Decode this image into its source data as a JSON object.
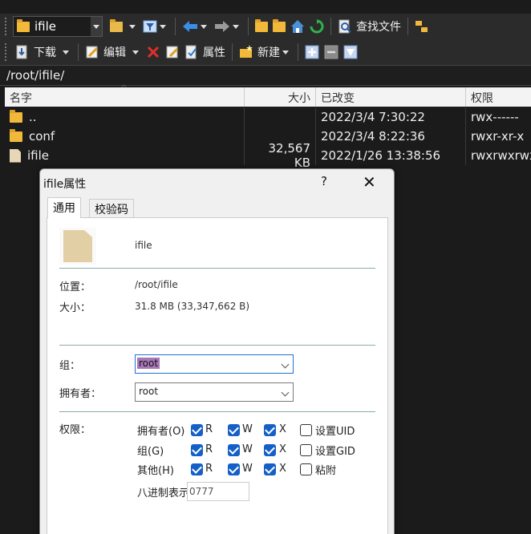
{
  "toolbar1": {
    "folder_combo": "ifile",
    "find_files": "查找文件"
  },
  "toolbar2": {
    "download": "下载",
    "edit": "编辑",
    "properties": "属性",
    "new": "新建"
  },
  "path": "/root/ifile/",
  "columns": {
    "name": "名字",
    "size": "大小",
    "modified": "已改变",
    "permissions": "权限"
  },
  "files": [
    {
      "name": "..",
      "size": "",
      "modified": "2022/3/4 7:30:22",
      "permissions": "rwx------",
      "icon": "parent-folder-icon"
    },
    {
      "name": "conf",
      "size": "",
      "modified": "2022/3/4 8:22:36",
      "permissions": "rwxr-xr-x",
      "icon": "folder-icon"
    },
    {
      "name": "ifile",
      "size": "32,567 KB",
      "modified": "2022/1/26 13:38:56",
      "permissions": "rwxrwxrwx",
      "icon": "file-icon"
    }
  ],
  "dialog": {
    "title": "ifile属性",
    "help": "?",
    "close": "✕",
    "tabs": [
      "通用",
      "校验码"
    ],
    "file_name": "ifile",
    "location_label": "位置：",
    "location": "/root/ifile",
    "size_label": "大小：",
    "size": "31.8 MB (33,347,662 B)",
    "group_label": "组：",
    "group": "root",
    "owner_label": "拥有者：",
    "owner": "root",
    "perm_label": "权限：",
    "perm_rows": [
      {
        "label": "拥有者(O)",
        "r": true,
        "w": true,
        "x": true,
        "extra": "设置UID",
        "extra_checked": false
      },
      {
        "label": "组(G)",
        "r": true,
        "w": true,
        "x": true,
        "extra": "设置GID",
        "extra_checked": false
      },
      {
        "label": "其他(H)",
        "r": true,
        "w": true,
        "x": true,
        "extra": "粘附",
        "extra_checked": false
      }
    ],
    "r": "R",
    "w": "W",
    "x": "X",
    "octal_label": "八进制表示",
    "octal": "0777"
  }
}
